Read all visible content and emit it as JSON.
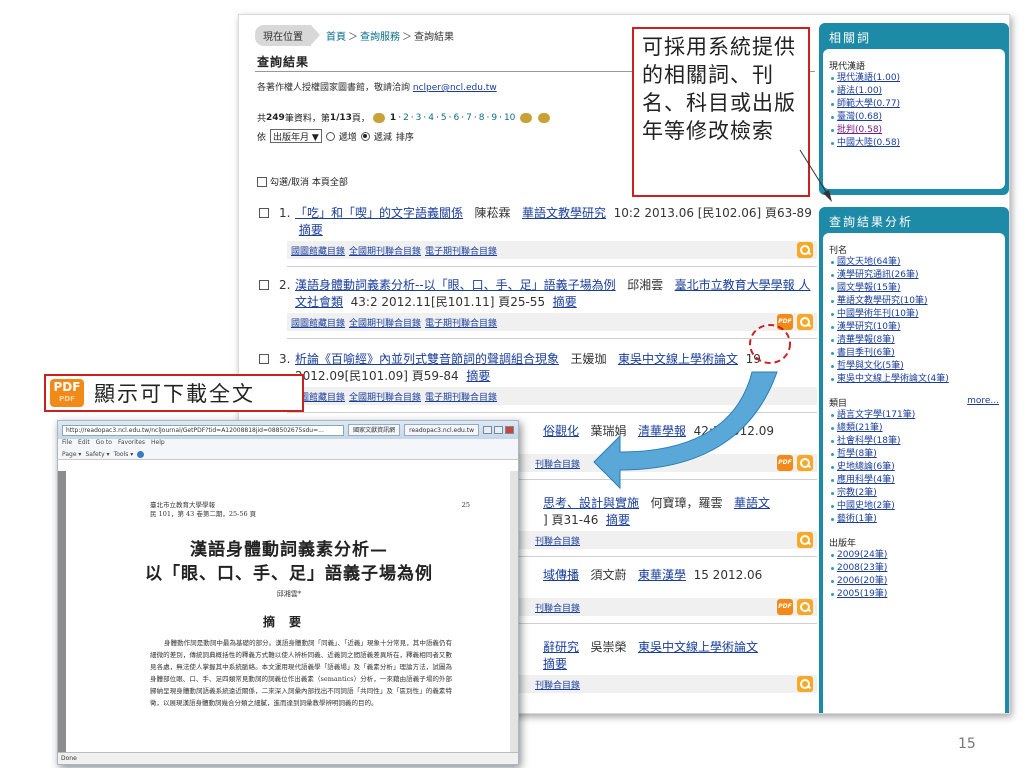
{
  "breadcrumb": {
    "location": "現在位置",
    "home": "首頁",
    "service": "查詢服務",
    "current": "查詢結果",
    "sep": "＞"
  },
  "result_title": "查詢結果",
  "copyright": {
    "text": "各著作權人授權國家圖書館，敬請洽詢 ",
    "email": "nclper@ncl.edu.tw"
  },
  "pager": {
    "prefix": "共 ",
    "total": "249",
    "mid": " 筆資料，第 ",
    "page": "1/13",
    "suffix": " 頁，",
    "pages": [
      "1",
      "2",
      "3",
      "4",
      "5",
      "6",
      "7",
      "8",
      "9",
      "10"
    ],
    "dot": "‧"
  },
  "sort": {
    "by": "依",
    "field": "出版年月 ▼",
    "asc": "遞增",
    "desc": "遞減",
    "tail": "排序"
  },
  "check_all": "勾選/取消 本頁全部",
  "link_labels": {
    "a": "國圖館藏目錄",
    "b": "全國期刊聯合目錄",
    "c": "電子期刊聯合目錄"
  },
  "abstract_label": "摘要",
  "results": [
    {
      "num": "1.",
      "title": "「吃」和「喫」的文字語義關係",
      "author": "陳菘霖",
      "journal": "華語文教學研究",
      "meta": "10:2 2013.06 [民102.06] 頁63-89"
    },
    {
      "num": "2.",
      "title": "漢語身體動詞義素分析--以「眼、口、手、足」語義子場為例",
      "author": "邱湘雲",
      "journal": "臺北市立教育大學學報 人文社會類",
      "meta": "43:2 2012.11[民101.11] 頁25-55"
    },
    {
      "num": "3.",
      "title": "析論《百喻經》內並列式雙音節詞的聲調組合現象",
      "author": "王媛珈",
      "journal": "東吳中文線上學術論文",
      "meta": "19 2012.09[民101.09] 頁59-84"
    },
    {
      "frag_title": "俗觀化",
      "author": "葉瑞娟",
      "journal": "清華學報",
      "meta": "42:3 2012.09"
    },
    {
      "frag_title": "思考、設計與實施",
      "author": "何寶璋，羅雲",
      "journal": "華語文",
      "meta": "] 頁31-46"
    },
    {
      "frag_title": "域傳播",
      "author": "須文蔚",
      "journal": "東華漢學",
      "meta": "15 2012.06"
    },
    {
      "frag_title": "辭研究",
      "author": "吳崇榮",
      "journal": "東吳中文線上學術論文",
      "meta": ""
    }
  ],
  "frag_links": "刊聯合目錄",
  "sidebar": {
    "related": {
      "title": "相關詞",
      "group": "現代漢語",
      "items": [
        "現代漢語(1.00)",
        "語法(1.00)",
        "師範大學(0.77)",
        "臺灣(0.68)",
        "批判(0.58)",
        "中國大陸(0.58)"
      ]
    },
    "analysis": {
      "title": "查詢結果分析",
      "journal_group": "刊名",
      "journals": [
        "國文天地(64筆)",
        "漢學研究通訊(26筆)",
        "國文學報(15筆)",
        "華語文教學研究(10筆)",
        "中國學術年刊(10筆)",
        "漢學研究(10筆)",
        "清華學報(8筆)",
        "書目季刊(6筆)",
        "哲學與文化(5筆)",
        "東吳中文線上學術論文(4筆)"
      ],
      "subject_group": "類目",
      "more": "more...",
      "subjects": [
        "語言文字學(171筆)",
        "總類(21筆)",
        "社會科學(18筆)",
        "哲學(8筆)",
        "史地總論(6筆)",
        "應用科學(4筆)",
        "宗教(2筆)",
        "中國史地(2筆)",
        "藝術(1筆)"
      ],
      "year_group": "出版年",
      "years": [
        "2009(24筆)",
        "2008(23筆)",
        "2006(20筆)",
        "2005(19筆)"
      ]
    }
  },
  "callout": "可採用系統提供的相關詞、刊名、科目或出版年等修改檢索",
  "pdf_label": {
    "badge": "PDF",
    "badge_sub": "PDF",
    "text": "顯示可下載全文"
  },
  "browser": {
    "url": "http://readopac3.ncl.edu.tw/nclJournal/GetPDF?tid=A12008818jid=088502675sdu=...",
    "tab1": "國家文獻資訊網",
    "tab2": "readopac3.ncl.edu.tw",
    "menu": [
      "File",
      "Edit",
      "Go to",
      "Favorites",
      "Help"
    ],
    "tools": [
      "Page ▾",
      "Safety ▾",
      "Tools ▾"
    ],
    "status": "Done"
  },
  "pdf_page": {
    "journal_line1": "臺北市立教育大學學報",
    "journal_line2": "民 101，第 43 卷第二期，25-56 頁",
    "page_no": "25",
    "title_line1": "漢語身體動詞義素分析—",
    "title_line2": "以「眼、口、手、足」語義子場為例",
    "author": "邱湘雲*",
    "abstract_heading": "摘要",
    "abstract": "身體動作詞是動詞中最為基礎的部分。漢語身體動詞「同義」、「近義」現象十分常見，其中語義仍有細微的差別，傳統詞典概括性的釋義方式難以使人辨析同義、近義詞之間語義差異所在，釋義相同者又數見各處，無法使人掌握其中系統脈絡。本文運用現代語義學「語義場」及「義素分析」理論方法，試圖為身體部位眼、口、手、足四類常見動詞的詞義位作出義素（semantics）分析，一來藉由語義子場的外部歸納呈現身體動詞語義系統遠近關係，二來深入詞彙內部找出不同詞語「共同性」及「區別性」的義素特徵，以展現漢語身體動詞幾合分類之細膩，進而達到詞彙教學辨明詞義的目的。"
  },
  "slide_number": "15"
}
